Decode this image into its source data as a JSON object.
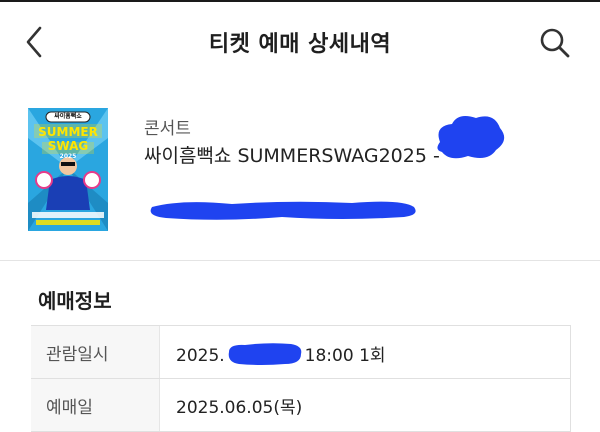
{
  "header": {
    "title": "티켓 예매 상세내역",
    "back_icon": "chevron-left-icon",
    "search_icon": "search-icon"
  },
  "ticket": {
    "category": "콘서트",
    "show_name": "싸이흠뻑쇼 SUMMERSWAG2025 -",
    "poster_text": "SUMMER SWAG",
    "poster_year": "2025",
    "poster_badge": "싸이흠뻑쇼"
  },
  "section": {
    "title": "예매정보"
  },
  "info": {
    "viewing": {
      "label": "관람일시",
      "value_prefix": "2025.",
      "value_suffix": "18:00 1회"
    },
    "booking": {
      "label": "예매일",
      "value": "2025.06.05(목)"
    }
  },
  "colors": {
    "redaction": "#1f43f0",
    "poster_bg": "#2aa6e0",
    "poster_title": "#ffe500"
  }
}
